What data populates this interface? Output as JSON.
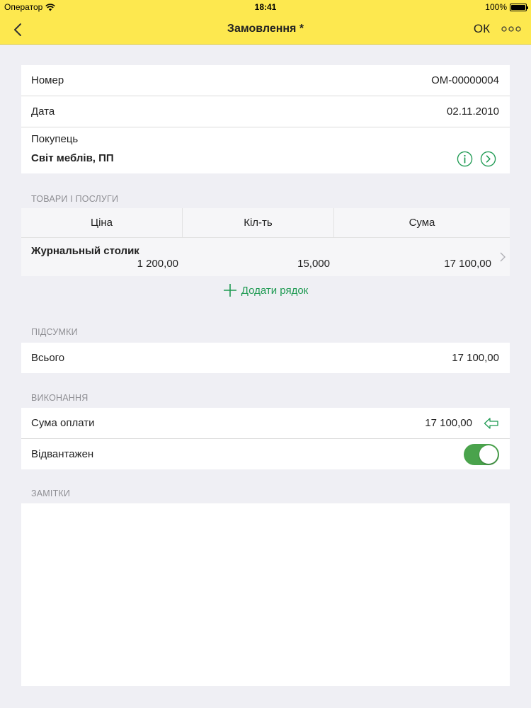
{
  "status_bar": {
    "carrier": "Оператор",
    "time": "18:41",
    "battery": "100%"
  },
  "nav": {
    "title": "Замовлення *",
    "ok_label": "ОК"
  },
  "header_fields": {
    "number_label": "Номер",
    "number_value": "ОМ-00000004",
    "date_label": "Дата",
    "date_value": "02.11.2010",
    "customer_label": "Покупець",
    "customer_value": "Світ меблів, ПП"
  },
  "goods": {
    "section_title": "ТОВАРИ І ПОСЛУГИ",
    "columns": [
      "Ціна",
      "Кіл-ть",
      "Сума"
    ],
    "rows": [
      {
        "name": "Журнальный столик",
        "price": "1 200,00",
        "qty": "15,000",
        "sum": "17 100,00"
      }
    ],
    "add_row_label": "Додати рядок"
  },
  "totals": {
    "section_title": "ПІДСУМКИ",
    "total_label": "Всього",
    "total_value": "17 100,00"
  },
  "execution": {
    "section_title": "ВИКОНАННЯ",
    "payment_label": "Сума оплати",
    "payment_value": "17 100,00",
    "shipped_label": "Відвантажен",
    "shipped_on": true
  },
  "notes": {
    "section_title": "ЗАМІТКИ",
    "text": ""
  },
  "colors": {
    "navbar": "#fde84f",
    "accent_green": "#1e9a52",
    "toggle_on": "#4aa34c"
  }
}
